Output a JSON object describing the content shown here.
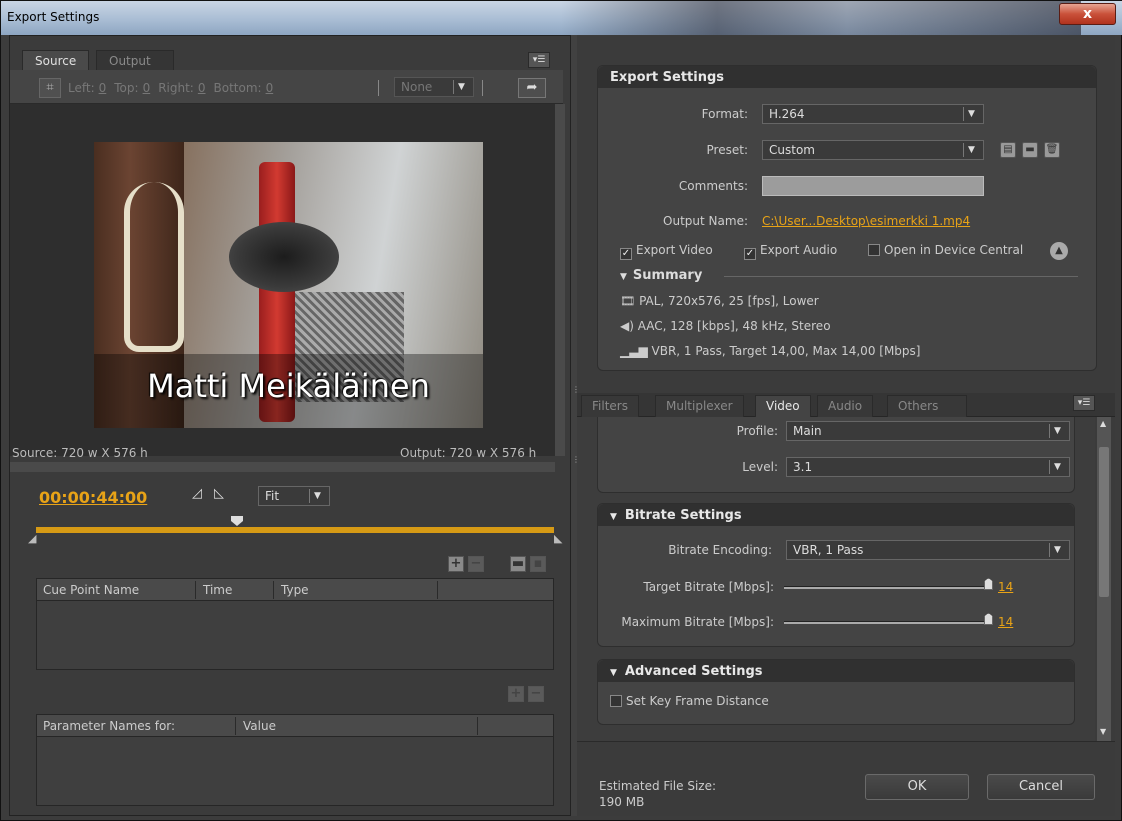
{
  "window": {
    "title": "Export Settings",
    "close_label": "x"
  },
  "left": {
    "tabs": [
      {
        "label": "Source"
      },
      {
        "label": "Output"
      }
    ],
    "crop": {
      "left_label": "Left:",
      "left_value": "0",
      "top_label": "Top:",
      "top_value": "0",
      "right_label": "Right:",
      "right_value": "0",
      "bottom_label": "Bottom:",
      "bottom_value": "0",
      "ratio": "None"
    },
    "video": {
      "caption": "Matti Meikäläinen"
    },
    "source_info": "Source: 720 w X 576 h",
    "output_info": "Output: 720 w X 576 h",
    "timecode": "00:00:44:00",
    "zoom": "Fit",
    "cue_table": {
      "headers": [
        "Cue Point Name",
        "Time",
        "Type"
      ]
    },
    "param_table": {
      "headers": [
        "Parameter Names for:",
        "Value"
      ]
    }
  },
  "export": {
    "heading": "Export Settings",
    "format_label": "Format:",
    "format_value": "H.264",
    "preset_label": "Preset:",
    "preset_value": "Custom",
    "comments_label": "Comments:",
    "comments_value": "",
    "output_name_label": "Output Name:",
    "output_name_value": "C:\\User...Desktop\\esimerkki 1.mp4",
    "export_video_label": "Export Video",
    "export_video_checked": true,
    "export_audio_label": "Export Audio",
    "export_audio_checked": true,
    "device_central_label": "Open in Device Central",
    "device_central_checked": false,
    "summary_label": "Summary",
    "summary_lines": [
      "PAL, 720x576, 25 [fps], Lower",
      "AAC, 128 [kbps], 48 kHz, Stereo",
      "VBR, 1 Pass, Target 14,00, Max 14,00 [Mbps]"
    ]
  },
  "right_tabs": [
    {
      "label": "Filters"
    },
    {
      "label": "Multiplexer"
    },
    {
      "label": "Video"
    },
    {
      "label": "Audio"
    },
    {
      "label": "Others"
    }
  ],
  "video_settings": {
    "profile_label": "Profile:",
    "profile_value": "Main",
    "level_label": "Level:",
    "level_value": "3.1"
  },
  "bitrate": {
    "heading": "Bitrate Settings",
    "encoding_label": "Bitrate Encoding:",
    "encoding_value": "VBR, 1 Pass",
    "target_label": "Target Bitrate [Mbps]:",
    "target_value": "14",
    "max_label": "Maximum Bitrate [Mbps]:",
    "max_value": "14"
  },
  "advanced": {
    "heading": "Advanced Settings",
    "keyframe_label": "Set Key Frame Distance",
    "keyframe_checked": false
  },
  "footer": {
    "size_label": "Estimated File Size:",
    "size_value": "190 MB",
    "ok_label": "OK",
    "cancel_label": "Cancel"
  },
  "colors": {
    "accent": "#e8a317",
    "panel": "#3b3b3b",
    "header": "#303030"
  }
}
